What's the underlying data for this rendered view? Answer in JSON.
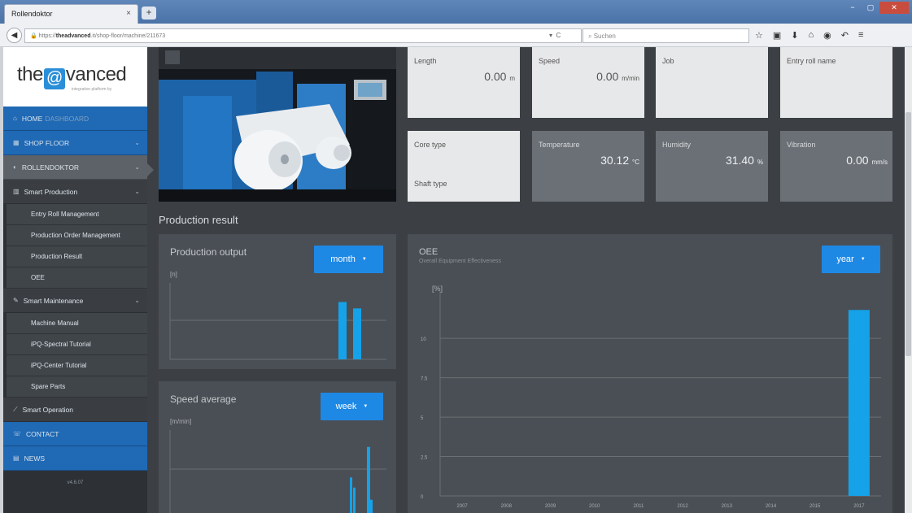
{
  "browser": {
    "tab_title": "Rollendoktor",
    "tab_close": "×",
    "new_tab": "+",
    "url_prefix": "https://",
    "url_domain": "theadvanced",
    "url_path": ".it/shop-floor/machine/211673",
    "search_placeholder": "Suchen",
    "toolbar_icons": [
      "☆",
      "▣",
      "⬇",
      "⌂",
      "◉",
      "↶",
      "≡"
    ]
  },
  "logo": {
    "before": "the",
    "at": "@",
    "after": "vanced",
    "tagline": "integrative platform by"
  },
  "sidebar": {
    "home_label": "HOME",
    "home_sub": "DASHBOARD",
    "shop_floor": "SHOP FLOOR",
    "rollendoktor": "ROLLENDOKTOR",
    "smart_production": "Smart Production",
    "entry_roll": "Entry Roll Management",
    "production_order": "Production Order Management",
    "production_result": "Production Result",
    "oee": "OEE",
    "smart_maintenance": "Smart Maintenance",
    "machine_manual": "Machine Manual",
    "ipq_spectral": "iPQ-Spectral Tutorial",
    "ipq_center": "iPQ-Center Tutorial",
    "spare_parts": "Spare Parts",
    "smart_operation": "Smart Operation",
    "contact": "CONTACT",
    "news": "NEWS",
    "version": "v4.6.07"
  },
  "tiles": {
    "length": {
      "label": "Length",
      "value": "0.00",
      "unit": "m"
    },
    "speed": {
      "label": "Speed",
      "value": "0.00",
      "unit": "m/min"
    },
    "job": {
      "label": "Job"
    },
    "entry_roll_name": {
      "label": "Entry roll name"
    },
    "core_type": {
      "label": "Core type"
    },
    "shaft_type": {
      "label": "Shaft type"
    },
    "temperature": {
      "label": "Temperature",
      "value": "30.12",
      "unit": "°C"
    },
    "humidity": {
      "label": "Humidity",
      "value": "31.40",
      "unit": "%"
    },
    "vibration": {
      "label": "Vibration",
      "value": "0.00",
      "unit": "mm/s"
    }
  },
  "production_result_title": "Production result",
  "production_output": {
    "title": "Production output",
    "unit": "[n]",
    "dropdown": "month",
    "values": [
      9,
      8
    ]
  },
  "speed_average": {
    "title": "Speed average",
    "unit": "[m/min]",
    "dropdown": "week",
    "values": [
      3.5,
      2.5,
      6.5,
      1.3
    ]
  },
  "chart_data": [
    {
      "type": "bar",
      "title": "OEE",
      "subtitle": "Overall Equipment Effectiveness",
      "ylabel": "[%]",
      "dropdown": "year",
      "categories": [
        "2007",
        "2008",
        "2009",
        "2010",
        "2011",
        "2012",
        "2013",
        "2014",
        "2015",
        "2017"
      ],
      "values": [
        0,
        0,
        0,
        0,
        0,
        0,
        0,
        0,
        0,
        11.8
      ],
      "yticks": [
        "0",
        "2.5",
        "5",
        "7.5",
        "10"
      ],
      "ylim": [
        0,
        13
      ],
      "grid": true
    }
  ],
  "colors": {
    "accent": "#1e88e5",
    "bar": "#15a2e8",
    "panel": "#4a4f55",
    "background": "#3c4045"
  }
}
